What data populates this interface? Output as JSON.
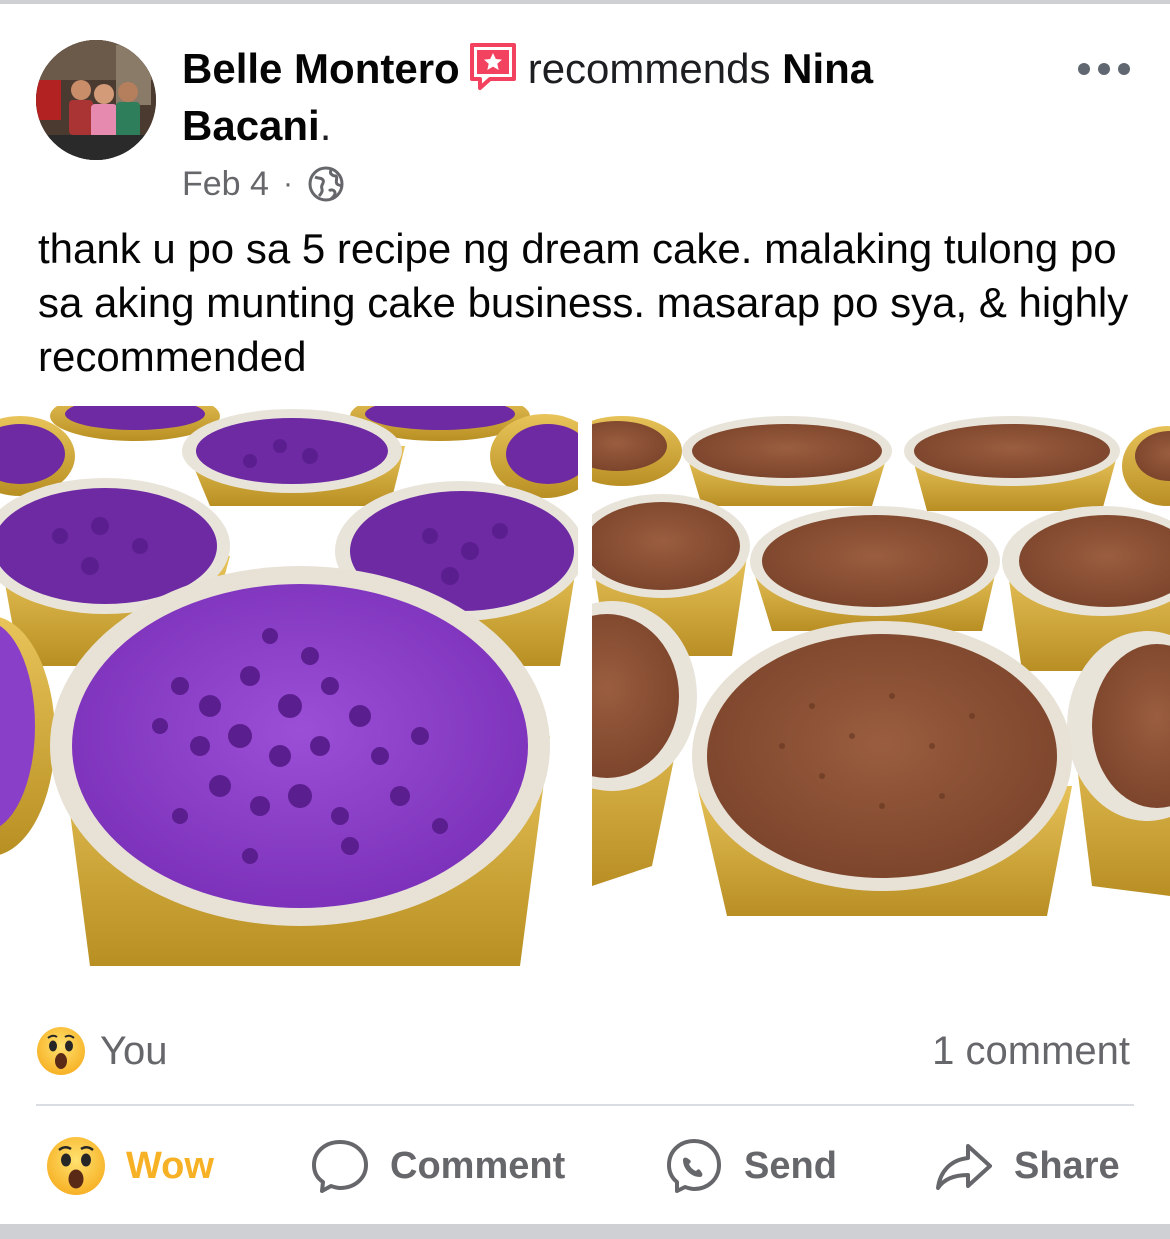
{
  "post": {
    "author": "Belle Montero",
    "action_text": "recommends",
    "page_name": "Nina Bacani",
    "page_suffix": ".",
    "date": "Feb 4",
    "separator": "·",
    "audience_icon": "globe-icon",
    "body": "thank u po sa 5 recipe ng dream cake. malaking tulong po sa aking munting cake business. masarap po sya, & highly recommended"
  },
  "reactions": {
    "summary": "You",
    "emoji": "wow-emoji",
    "comments": "1 comment"
  },
  "actions": {
    "wow_label": "Wow",
    "comment_label": "Comment",
    "send_label": "Send",
    "share_label": "Share"
  },
  "colors": {
    "wow_accent": "#f7b125",
    "recommend_badge": "#f3425f",
    "secondary_text": "#65676b",
    "ube_purple": "#7a2fb8",
    "cocoa_brown": "#8a4f33",
    "foil_gold": "#c9a232"
  }
}
